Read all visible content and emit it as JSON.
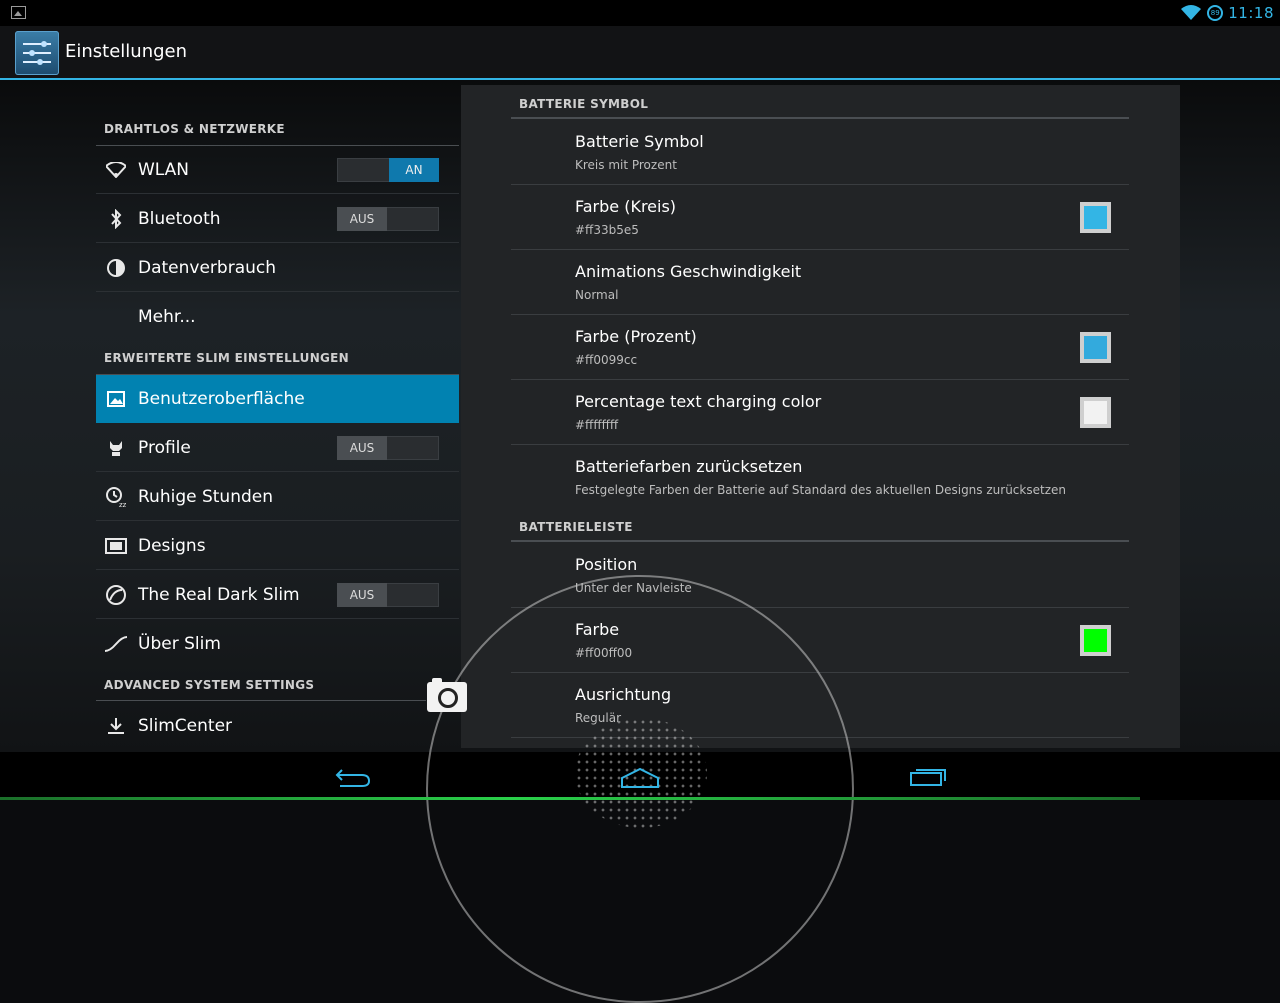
{
  "status_bar": {
    "time": "11:18",
    "battery_text": "89"
  },
  "action_bar": {
    "title": "Einstellungen"
  },
  "sidebar": {
    "categories": [
      {
        "label": "DRAHTLOS & NETZWERKE"
      },
      {
        "label": "ERWEITERTE SLIM EINSTELLUNGEN"
      },
      {
        "label": "ADVANCED SYSTEM SETTINGS"
      }
    ],
    "items": [
      {
        "label": "WLAN",
        "icon": "wifi-icon",
        "toggle": "AN"
      },
      {
        "label": "Bluetooth",
        "icon": "bluetooth-icon",
        "toggle": "AUS"
      },
      {
        "label": "Datenverbrauch",
        "icon": "data-usage-icon"
      },
      {
        "label": "Mehr..."
      },
      {
        "label": "Benutzeroberfläche",
        "icon": "interface-icon",
        "selected": true
      },
      {
        "label": "Profile",
        "icon": "profile-icon",
        "toggle": "AUS"
      },
      {
        "label": "Ruhige Stunden",
        "icon": "quiet-hours-icon"
      },
      {
        "label": "Designs",
        "icon": "themes-icon"
      },
      {
        "label": "The Real Dark Slim",
        "icon": "dark-slim-icon",
        "toggle": "AUS"
      },
      {
        "label": "Über Slim",
        "icon": "slim-logo-icon"
      },
      {
        "label": "SlimCenter",
        "icon": "download-icon"
      }
    ]
  },
  "panel": {
    "sections": [
      {
        "label": "BATTERIE SYMBOL",
        "prefs": [
          {
            "title": "Batterie Symbol",
            "summary": "Kreis mit Prozent"
          },
          {
            "title": "Farbe (Kreis)",
            "summary": "#ff33b5e5",
            "swatch": "#33b5e5"
          },
          {
            "title": "Animations Geschwindigkeit",
            "summary": "Normal"
          },
          {
            "title": "Farbe (Prozent)",
            "summary": "#ff0099cc",
            "swatch": "#33aadd"
          },
          {
            "title": "Percentage text charging color",
            "summary": "#ffffffff",
            "swatch": "#f2f2f2"
          },
          {
            "title": "Batteriefarben zurücksetzen",
            "summary": "Festgelegte Farben der Batterie auf Standard des aktuellen Designs zurücksetzen"
          }
        ]
      },
      {
        "label": "BATTERIELEISTE",
        "prefs": [
          {
            "title": "Position",
            "summary": "Unter der Navleiste"
          },
          {
            "title": "Farbe",
            "summary": "#ff00ff00",
            "swatch": "#00ff00"
          },
          {
            "title": "Ausrichtung",
            "summary": "Regulär"
          }
        ]
      }
    ]
  },
  "colors": {
    "accent": "#33b5e5",
    "selected": "#0182b1"
  }
}
